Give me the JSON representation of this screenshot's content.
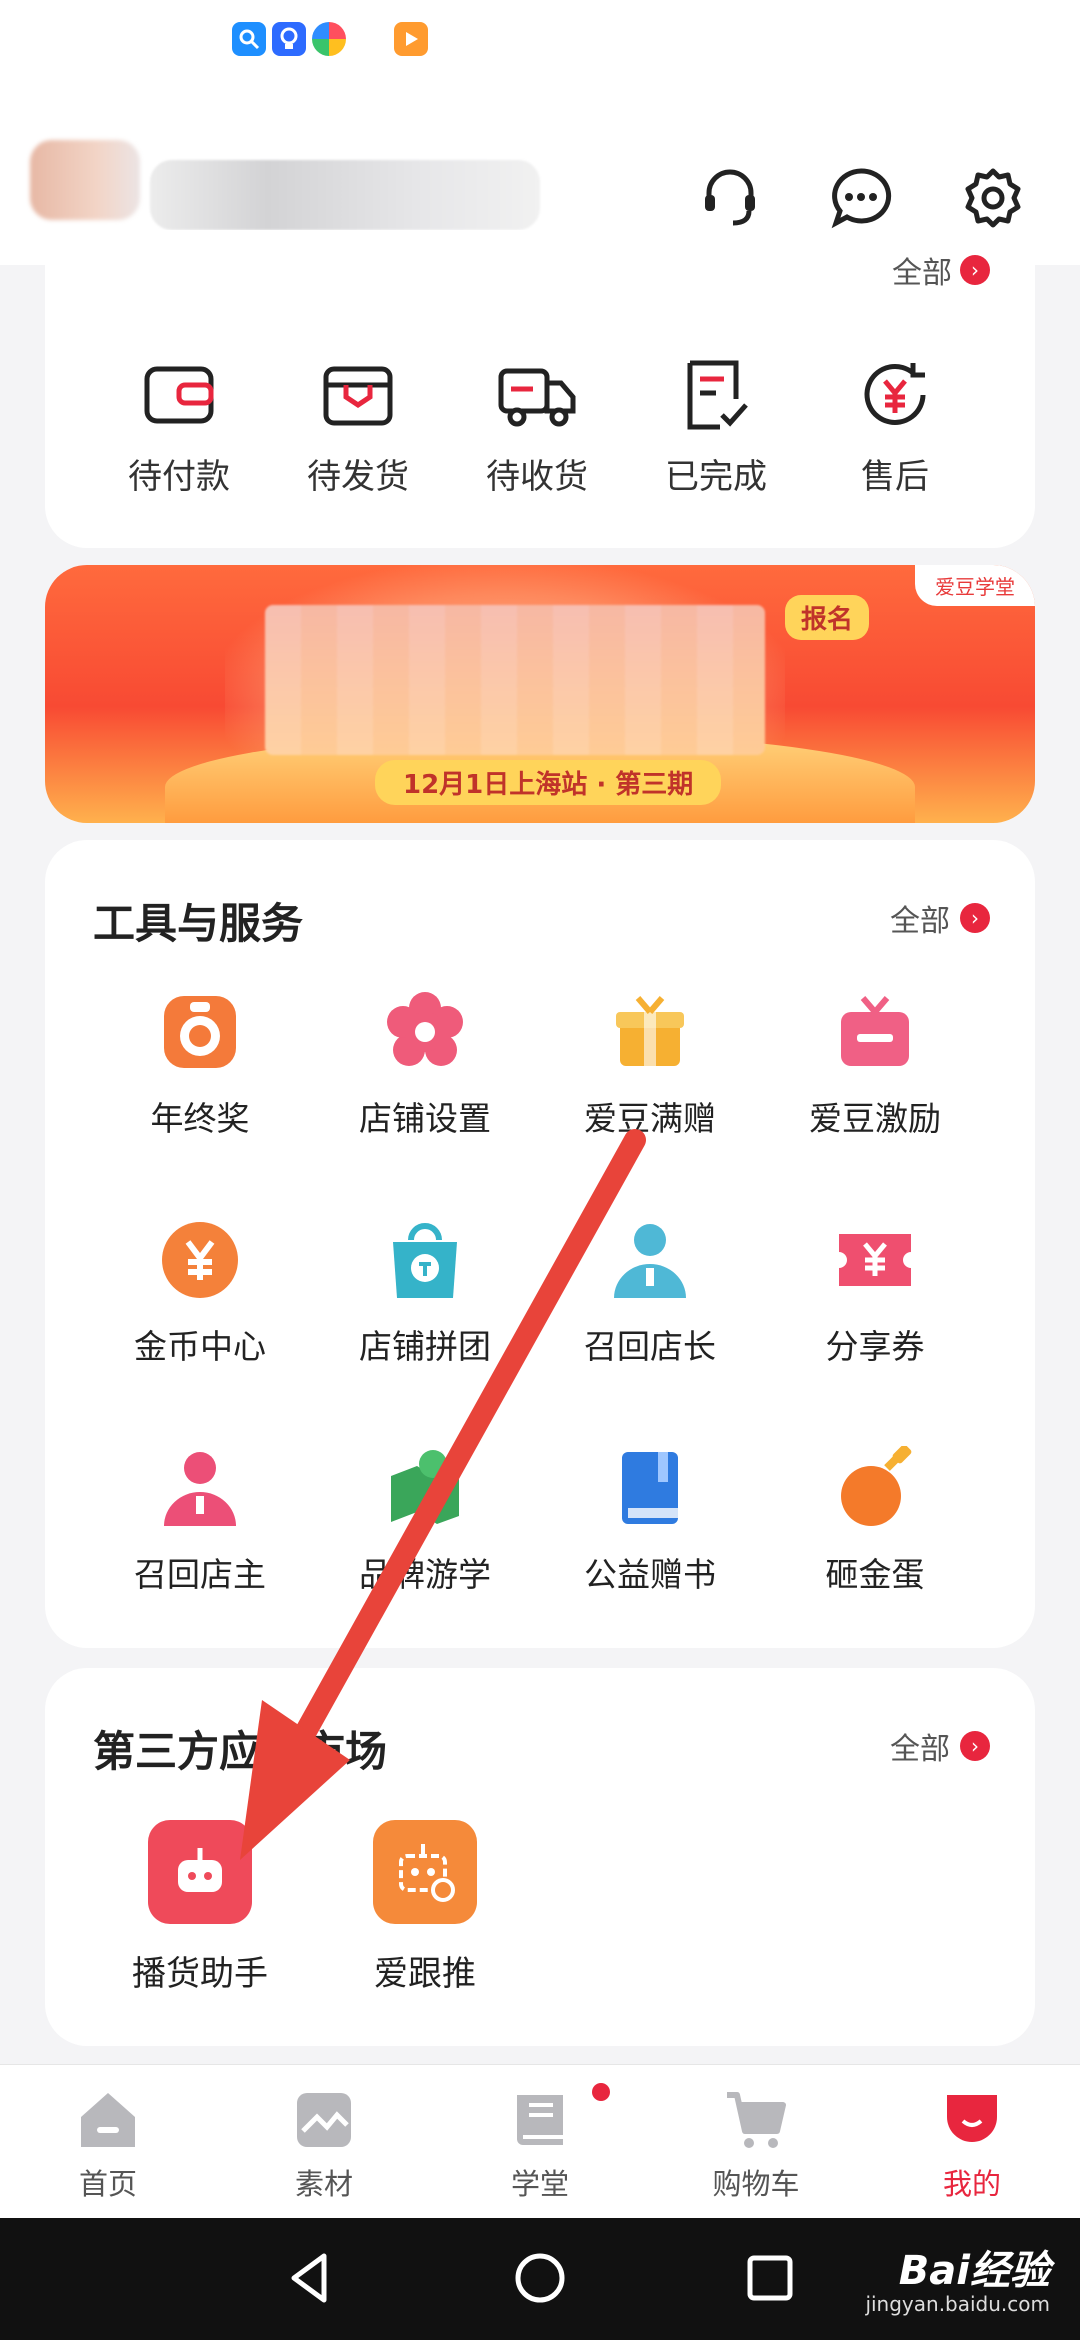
{
  "orders": {
    "all_label": "全部",
    "items": [
      {
        "label": "待付款",
        "icon": "wallet-icon"
      },
      {
        "label": "待发货",
        "icon": "package-icon"
      },
      {
        "label": "待收货",
        "icon": "truck-icon"
      },
      {
        "label": "已完成",
        "icon": "checked-document-icon"
      },
      {
        "label": "售后",
        "icon": "refund-icon"
      }
    ]
  },
  "banner": {
    "tag": "爱豆学堂",
    "caption": "12月1日上海站 · 第三期",
    "side_text": "报名"
  },
  "tools": {
    "title": "工具与服务",
    "all_label": "全部",
    "items": [
      {
        "label": "年终奖",
        "icon": "bonus-bag-icon"
      },
      {
        "label": "店铺设置",
        "icon": "flower-gear-icon"
      },
      {
        "label": "爱豆满赠",
        "icon": "gift-box-icon"
      },
      {
        "label": "爱豆激励",
        "icon": "reward-gift-icon"
      },
      {
        "label": "金币中心",
        "icon": "yen-coin-icon"
      },
      {
        "label": "店铺拼团",
        "icon": "shopping-bag-icon"
      },
      {
        "label": "召回店长",
        "icon": "user-blue-icon"
      },
      {
        "label": "分享券",
        "icon": "coupon-icon"
      },
      {
        "label": "召回店主",
        "icon": "user-pink-icon"
      },
      {
        "label": "品牌游学",
        "icon": "brand-travel-icon"
      },
      {
        "label": "公益赠书",
        "icon": "book-icon"
      },
      {
        "label": "砸金蛋",
        "icon": "golden-egg-icon"
      }
    ]
  },
  "third_party": {
    "title": "第三方应用市场",
    "all_label": "全部",
    "apps": [
      {
        "label": "播货助手",
        "icon": "robot-icon"
      },
      {
        "label": "爱跟推",
        "icon": "robot-gear-icon"
      }
    ]
  },
  "nav": {
    "items": [
      {
        "label": "首页",
        "icon": "home-icon"
      },
      {
        "label": "素材",
        "icon": "image-icon"
      },
      {
        "label": "学堂",
        "icon": "book-nav-icon"
      },
      {
        "label": "购物车",
        "icon": "cart-icon"
      },
      {
        "label": "我的",
        "icon": "profile-icon"
      }
    ],
    "active_index": 4
  },
  "watermark": {
    "text": "Bai经验",
    "sub": "jingyan.baidu.com"
  },
  "colors": {
    "accent": "#e8263e",
    "background": "#f4f4f6"
  }
}
